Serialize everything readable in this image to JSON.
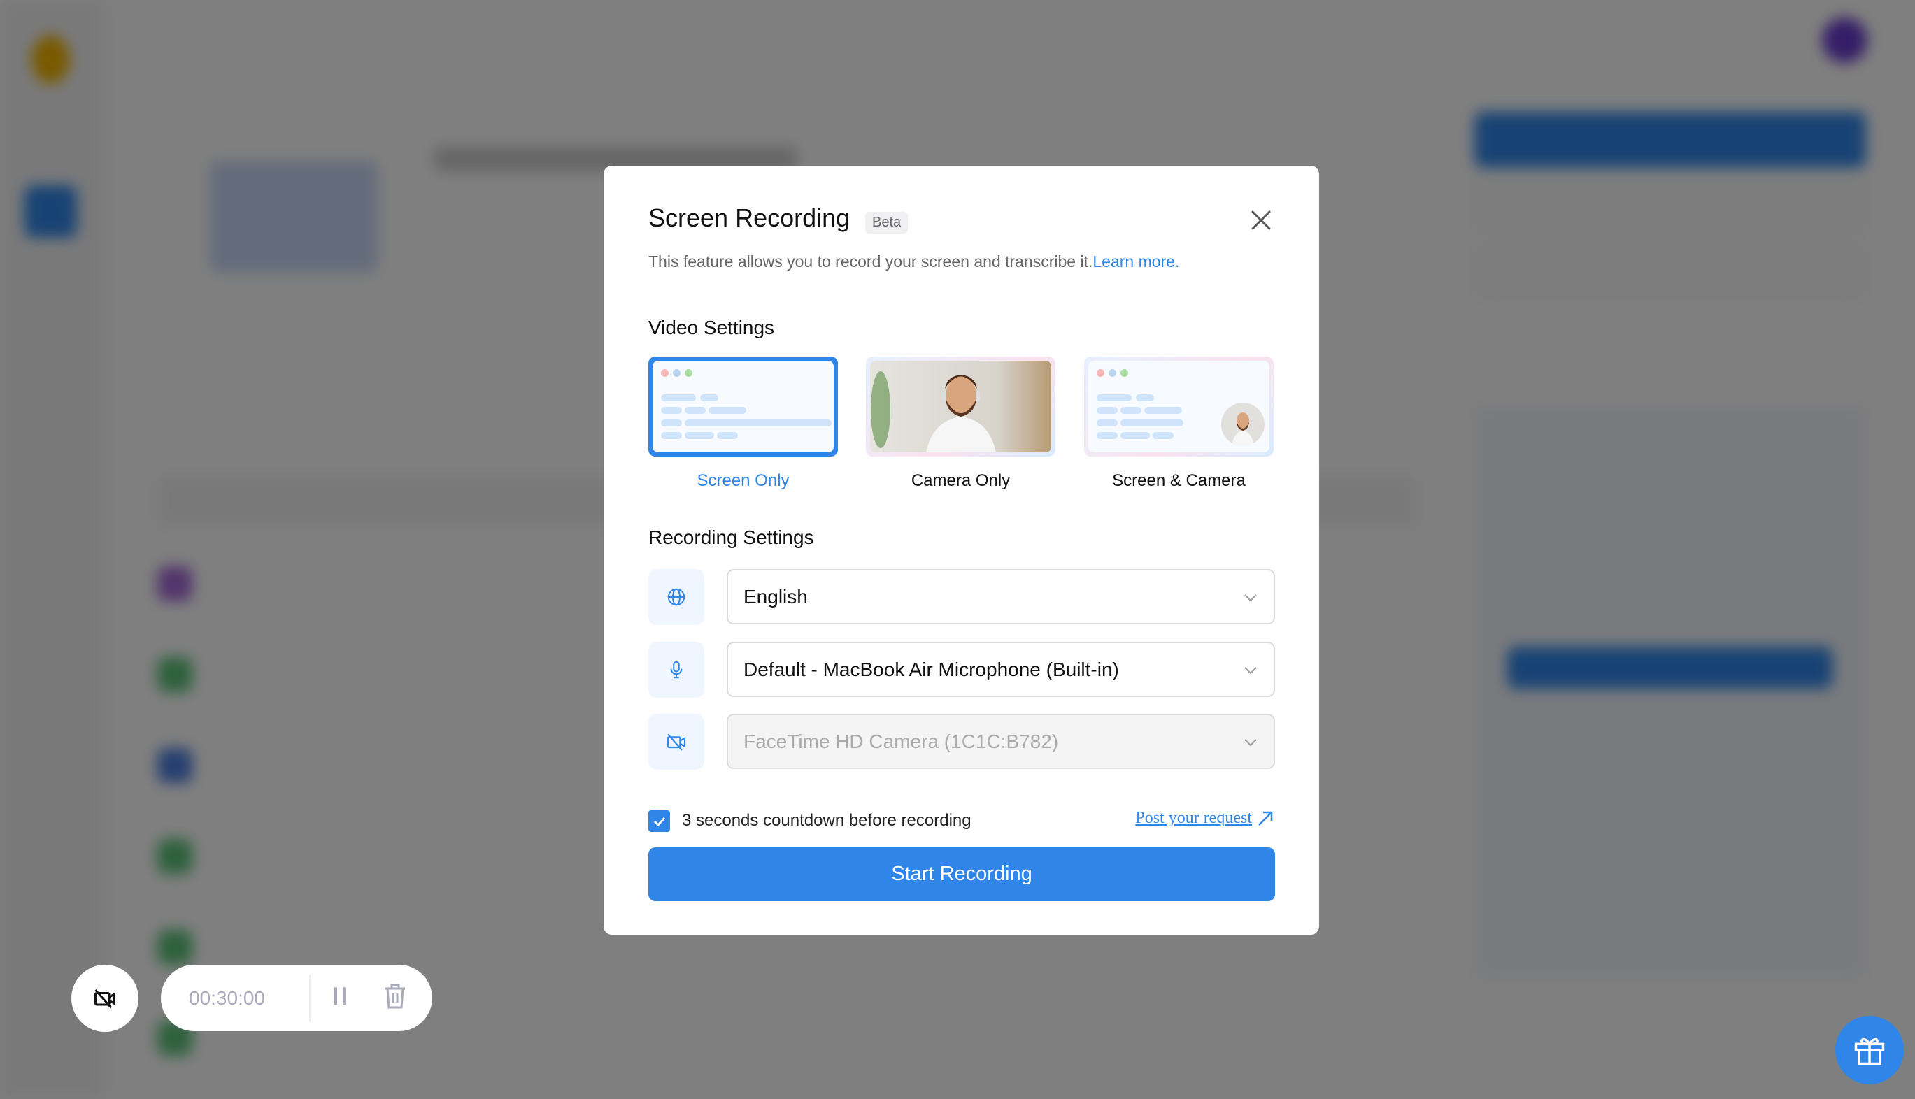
{
  "modal": {
    "title": "Screen Recording",
    "badge": "Beta",
    "description": "This feature allows you to record your screen and transcribe it.",
    "learn_more": "Learn more.",
    "video_settings_heading": "Video Settings",
    "video_options": [
      {
        "label": "Screen Only",
        "selected": true
      },
      {
        "label": "Camera Only",
        "selected": false
      },
      {
        "label": "Screen & Camera",
        "selected": false
      }
    ],
    "recording_settings_heading": "Recording Settings",
    "language": {
      "icon": "globe-icon",
      "value": "English"
    },
    "microphone": {
      "icon": "microphone-icon",
      "value": "Default - MacBook Air Microphone (Built-in)"
    },
    "camera": {
      "icon": "camera-off-icon",
      "value": "FaceTime HD Camera (1C1C:B782)",
      "disabled": true
    },
    "countdown_label": "3 seconds countdown before recording",
    "countdown_checked": true,
    "post_request": "Post your request",
    "start_button": "Start Recording"
  },
  "recorder": {
    "timer": "00:30:00"
  },
  "colors": {
    "accent": "#2f86e8",
    "overlay": "rgba(0,0,0,0.5)"
  }
}
